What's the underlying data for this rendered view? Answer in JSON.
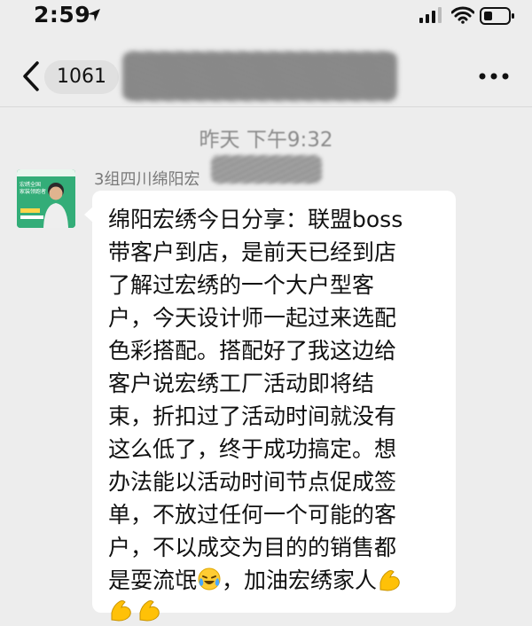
{
  "status_bar": {
    "time": "2:59"
  },
  "nav": {
    "unread_count": "1061"
  },
  "chat": {
    "timestamp": "昨天 下午9:32",
    "sender_name": "3组四川绵阳宏",
    "avatar_caption": "宏绣全国 家装领跑者",
    "message_lines": [
      "绵阳宏绣今日分享：联盟boss",
      "带客户到店，是前天已经到店",
      "了解过宏绣的一个大户型客",
      "户，今天设计师一起过来选配",
      "色彩搭配。搭配好了我这边给",
      "客户说宏绣工厂活动即将结",
      "束，折扣过了活动时间就没有",
      "这么低了，终于成功搞定。想",
      "办法能以活动时间节点促成签",
      "单，不放过任何一个可能的客",
      "户，不以成交为目的的销售都",
      "是耍流氓",
      "，加油宏绣家人"
    ]
  },
  "icons": {
    "location": "location-arrow-icon",
    "signal": "cellular-signal-icon",
    "wifi": "wifi-icon",
    "battery": "battery-icon",
    "back": "chevron-left-icon",
    "more": "more-dots-icon",
    "emoji_laugh_cry": "laughing-crying-emoji-icon",
    "emoji_muscle": "flexed-biceps-emoji-icon"
  }
}
